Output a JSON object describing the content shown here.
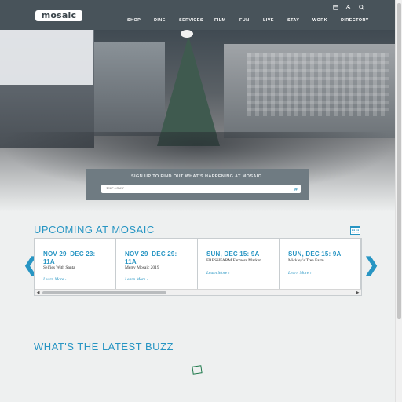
{
  "header": {
    "logo": "mosaic",
    "nav": [
      "SHOP",
      "DINE",
      "SERVICES",
      "FILM",
      "FUN",
      "LIVE",
      "STAY",
      "WORK",
      "DIRECTORY"
    ],
    "utility_icons": [
      "calendar-icon",
      "map-icon",
      "search-icon"
    ]
  },
  "signup": {
    "title": "SIGN UP TO FIND OUT WHAT'S HAPPENING AT MOSAIC.",
    "placeholder": "Your Email",
    "submit_glyph": "»"
  },
  "upcoming": {
    "title": "UPCOMING AT MOSAIC",
    "prev_glyph": "❮",
    "next_glyph": "❯",
    "events": [
      {
        "date_line1": "NOV 29–DEC 23:",
        "date_line2": "11A",
        "name": "Selfies With Santa",
        "link": "Learn More ›"
      },
      {
        "date_line1": "NOV 29–DEC 29:",
        "date_line2": "11A",
        "name": "Merry Mosaic 2019",
        "link": "Learn More ›"
      },
      {
        "date_line1": "SUN, DEC 15: 9A",
        "date_line2": "",
        "name": "FRESHFARM Farmers Market",
        "link": "Learn More ›"
      },
      {
        "date_line1": "SUN, DEC 15: 9A",
        "date_line2": "",
        "name": "Mickley's Tree Farm",
        "link": "Learn More ›"
      }
    ]
  },
  "buzz": {
    "title": "WHAT'S THE LATEST BUZZ"
  },
  "colors": {
    "header_bg": "#48535a",
    "accent": "#2795c3",
    "signup_bg": "#6f7b82",
    "page_bg": "#eef0f0"
  }
}
